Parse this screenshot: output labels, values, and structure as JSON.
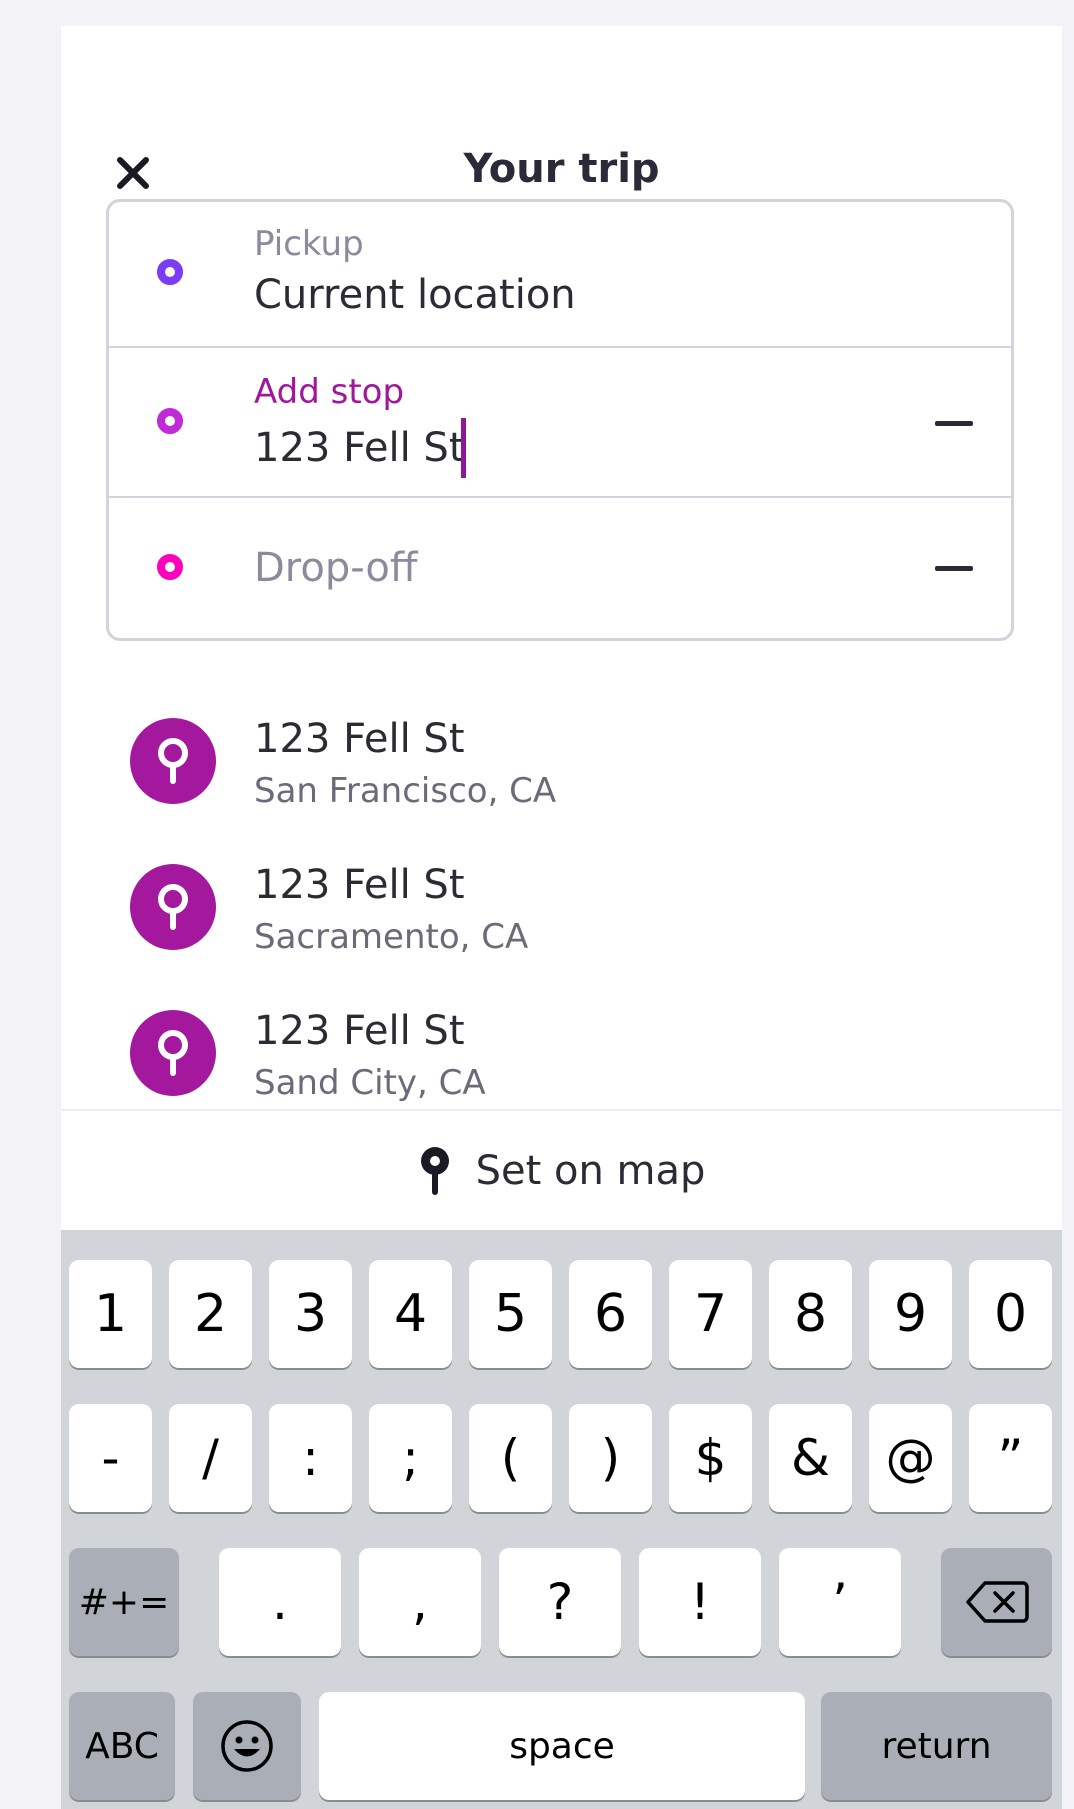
{
  "header": {
    "title": "Your trip",
    "close_icon": "close-icon"
  },
  "trip": {
    "pickup": {
      "label": "Pickup",
      "value": "Current location",
      "dot_color": "#7b3cf6"
    },
    "stop": {
      "label": "Add stop",
      "value": "123 Fell St",
      "dot_color": "#c12ad8"
    },
    "dropoff": {
      "placeholder": "Drop-off",
      "dot_color": "#ff00bf"
    }
  },
  "suggestions": [
    {
      "title": "123 Fell St",
      "subtitle": "San Francisco, CA"
    },
    {
      "title": "123 Fell St",
      "subtitle": "Sacramento, CA"
    },
    {
      "title": "123 Fell St",
      "subtitle": "Sand City, CA"
    }
  ],
  "set_on_map": {
    "label": "Set on map"
  },
  "keyboard": {
    "row1": [
      "1",
      "2",
      "3",
      "4",
      "5",
      "6",
      "7",
      "8",
      "9",
      "0"
    ],
    "row2": [
      "-",
      "/",
      ":",
      ";",
      "(",
      ")",
      "$",
      "&",
      "@",
      "”"
    ],
    "row3": [
      ".",
      ",",
      "?",
      "!",
      "’"
    ],
    "more_symbols": "#+=",
    "abc": "ABC",
    "space": "space",
    "return": "return"
  },
  "colors": {
    "accent": "#a3189d",
    "keyboard_bg": "#d1d4d9"
  }
}
